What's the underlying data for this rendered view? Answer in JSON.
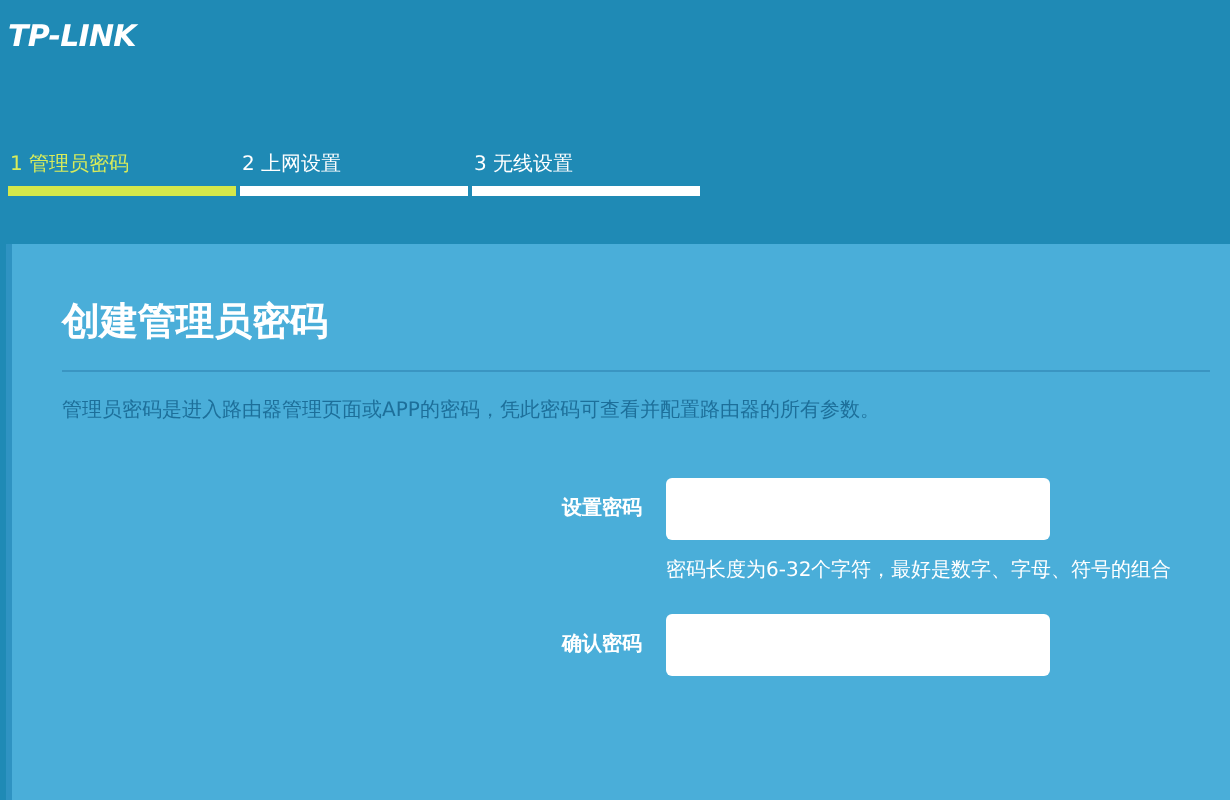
{
  "header": {
    "logo": "TP-LINK"
  },
  "steps": [
    {
      "label": "1 管理员密码",
      "selected": true
    },
    {
      "label": "2 上网设置",
      "selected": false
    },
    {
      "label": "3 无线设置",
      "selected": false
    }
  ],
  "panel": {
    "title": "创建管理员密码",
    "description": "管理员密码是进入路由器管理页面或APP的密码，凭此密码可查看并配置路由器的所有参数。",
    "fields": [
      {
        "label": "设置密码",
        "hint": "密码长度为6-32个字符，最好是数字、字母、符号的组合"
      },
      {
        "label": "确认密码"
      }
    ]
  }
}
